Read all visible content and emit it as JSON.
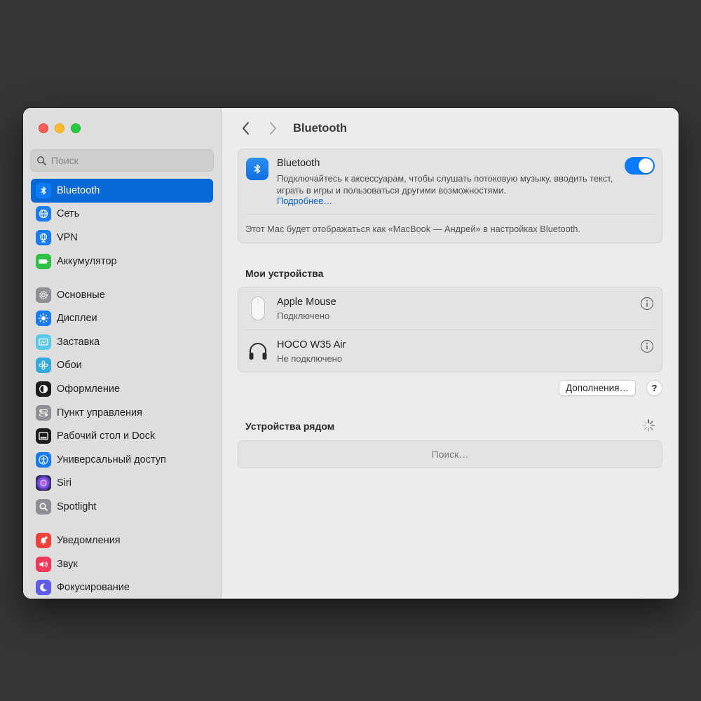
{
  "window": {
    "traffic_lights": [
      "close",
      "minimize",
      "zoom"
    ]
  },
  "sidebar": {
    "search_placeholder": "Поиск",
    "items": [
      {
        "label": "Bluetooth",
        "icon": "bluetooth-icon",
        "color": "#0a7afe",
        "selected": true
      },
      {
        "label": "Сеть",
        "icon": "globe-icon",
        "color": "#1a7cf5"
      },
      {
        "label": "VPN",
        "icon": "vpn-globe-icon",
        "color": "#1a7cf5"
      },
      {
        "label": "Аккумулятор",
        "icon": "battery-icon",
        "color": "#30c048"
      },
      {
        "label": "Основные",
        "icon": "gear-icon",
        "color": "#8e8e93"
      },
      {
        "label": "Дисплеи",
        "icon": "sun-icon",
        "color": "#1a7cf5"
      },
      {
        "label": "Заставка",
        "icon": "screensaver-icon",
        "color": "#5ac8e8"
      },
      {
        "label": "Обои",
        "icon": "flower-icon",
        "color": "#34aadc"
      },
      {
        "label": "Оформление",
        "icon": "appearance-icon",
        "color": "#1c1c1e"
      },
      {
        "label": "Пункт управления",
        "icon": "control-center-icon",
        "color": "#8e8e93"
      },
      {
        "label": "Рабочий стол и Dock",
        "icon": "dock-icon",
        "color": "#1c1c1e"
      },
      {
        "label": "Универсальный доступ",
        "icon": "accessibility-icon",
        "color": "#1a7cf5"
      },
      {
        "label": "Siri",
        "icon": "siri-icon",
        "color": "#3a3a8c"
      },
      {
        "label": "Spotlight",
        "icon": "magnifier-icon",
        "color": "#8e8e93"
      },
      {
        "label": "Уведомления",
        "icon": "bell-icon",
        "color": "#f0413a"
      },
      {
        "label": "Звук",
        "icon": "speaker-icon",
        "color": "#f0385a"
      },
      {
        "label": "Фокусирование",
        "icon": "moon-icon",
        "color": "#5e5ce6"
      }
    ]
  },
  "toolbar": {
    "title": "Bluetooth"
  },
  "bluetooth": {
    "title": "Bluetooth",
    "description": "Подключайтесь к аксессуарам, чтобы слушать потоковую музыку, вводить текст, играть в игры и пользоваться другими возможностями.",
    "link": "Подробнее…",
    "enabled": true,
    "footer": "Этот Mac будет отображаться как «MacBook — Андрей» в настройках Bluetooth.",
    "accent": "#0a7afe"
  },
  "my_devices": {
    "title": "Мои устройства",
    "items": [
      {
        "name": "Apple Mouse",
        "status": "Подключено",
        "icon": "mouse-icon"
      },
      {
        "name": "HOCO W35 Air",
        "status": "Не подключено",
        "icon": "headphones-icon"
      }
    ]
  },
  "buttons": {
    "extras": "Дополнения…",
    "help": "?"
  },
  "nearby": {
    "title": "Устройства рядом",
    "searching": "Поиск…"
  }
}
